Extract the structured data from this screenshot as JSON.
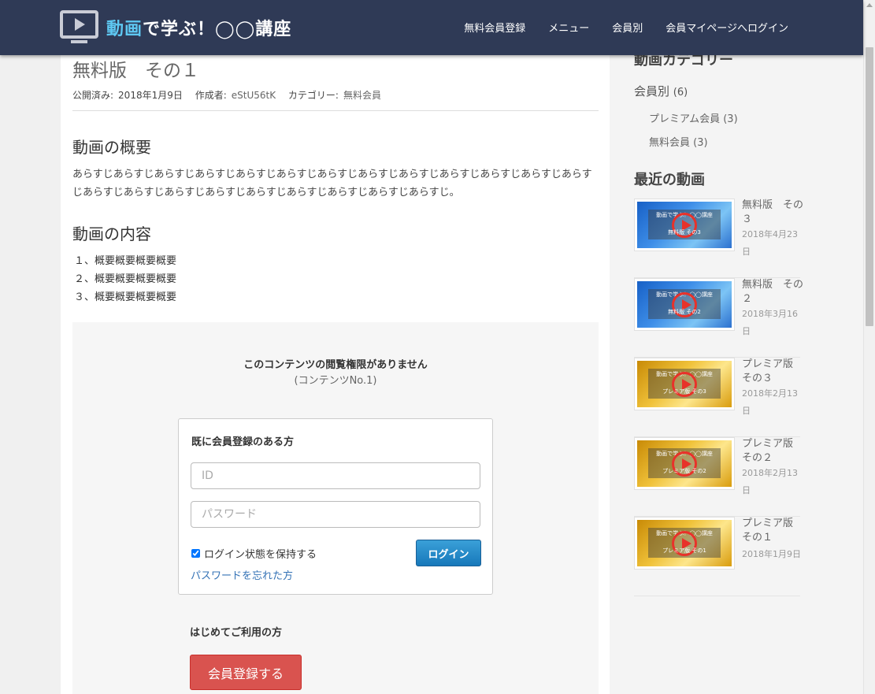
{
  "header": {
    "logo_accent": "動画",
    "logo_rest": "で学ぶ！◯◯講座",
    "nav": [
      "無料会員登録",
      "メニュー",
      "会員別",
      "会員マイページへログイン"
    ]
  },
  "post": {
    "title": "無料版　その１",
    "meta": {
      "published_label": "公開済み:",
      "published_date": "2018年1月9日",
      "author_label": "作成者:",
      "author": "eStU56tK",
      "category_label": "カテゴリー:",
      "category": "無料会員"
    },
    "overview_heading": "動画の概要",
    "overview_text": "あらすじあらすじあらすじあらすじあらすじあらすじあらすじあらすじあらすじあらすじあらすじあらすじあらすじあらすじあらすじあらすじあらすじあらすじあらすじあらすじあらすじあらすじ。",
    "content_heading": "動画の内容",
    "content_items": [
      "１、概要概要概要概要",
      "２、概要概要概要概要",
      "３、概要概要概要概要"
    ]
  },
  "restricted": {
    "message": "このコンテンツの閲覧権限がありません",
    "content_no": "(コンテンツNo.1)",
    "login": {
      "title": "既に会員登録のある方",
      "id_placeholder": "ID",
      "password_placeholder": "パスワード",
      "remember_label": "ログイン状態を保持する",
      "remember_checked": true,
      "login_button": "ログイン",
      "forgot_link": "パスワードを忘れた方"
    },
    "first_time_label": "はじめてご利用の方",
    "register_button": "会員登録する"
  },
  "sidebar": {
    "category_heading": "動画カテゴリー",
    "category_root": {
      "label": "会員別",
      "count": "(6)"
    },
    "category_children": [
      {
        "label": "プレミアム会員",
        "count": "(3)"
      },
      {
        "label": "無料会員",
        "count": "(3)"
      }
    ],
    "recent_heading": "最近の動画",
    "recent": [
      {
        "title": "無料版　その３",
        "date": "2018年4月23日",
        "theme": "blue",
        "thumb_caption": "無料版 その3"
      },
      {
        "title": "無料版　その２",
        "date": "2018年3月16日",
        "theme": "blue",
        "thumb_caption": "無料版 その2"
      },
      {
        "title": "プレミア版 その３",
        "date": "2018年2月13日",
        "theme": "gold",
        "thumb_caption": "プレミア版 その3"
      },
      {
        "title": "プレミア版 その２",
        "date": "2018年2月13日",
        "theme": "gold",
        "thumb_caption": "プレミア版 その2"
      },
      {
        "title": "プレミア版 その１",
        "date": "2018年1月9日",
        "theme": "gold",
        "thumb_caption": "プレミア版 その1"
      }
    ],
    "thumb_heading": "動画で学ぶ！◯◯講座"
  },
  "colors": {
    "header_bg": "#2f3a56",
    "logo_accent": "#5ec8f2",
    "login_button": "#1778ba",
    "register_button": "#d9534f",
    "link": "#3573b6"
  }
}
